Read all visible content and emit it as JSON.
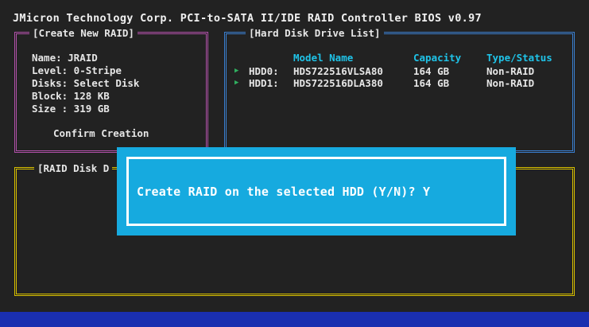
{
  "header": {
    "title": "JMicron Technology Corp. PCI-to-SATA II/IDE RAID Controller BIOS v0.97"
  },
  "create_panel": {
    "title": "[Create New RAID]",
    "name": "Name: JRAID",
    "level": "Level: 0-Stripe",
    "disks": "Disks: Select Disk",
    "block": "Block: 128 KB",
    "size": "Size : 319 GB",
    "confirm": "Confirm Creation"
  },
  "hdd_panel": {
    "title": "[Hard Disk Drive List]",
    "columns": [
      "Model Name",
      "Capacity",
      "Type/Status"
    ],
    "rows": [
      {
        "id": "HDD0:",
        "model": "HDS722516VLSA80",
        "capacity": "164 GB",
        "status": "Non-RAID"
      },
      {
        "id": "HDD1:",
        "model": "HDS722516DLA380",
        "capacity": "164 GB",
        "status": "Non-RAID"
      }
    ]
  },
  "member_panel": {
    "title": "[RAID Disk D"
  },
  "dialog": {
    "prompt": "Create RAID on the selected HDD (Y/N)? Y"
  },
  "colors": {
    "background": "#222222",
    "create_border": "#b050a8",
    "hdd_border": "#3a7fd0",
    "member_border": "#d8c000",
    "dialog": "#16aadf",
    "column_header": "#1fc3e8",
    "arrow": "#30b060",
    "bottom_bar": "#1a2fb0"
  },
  "icons": {
    "row_arrow": "play-arrow-icon"
  }
}
